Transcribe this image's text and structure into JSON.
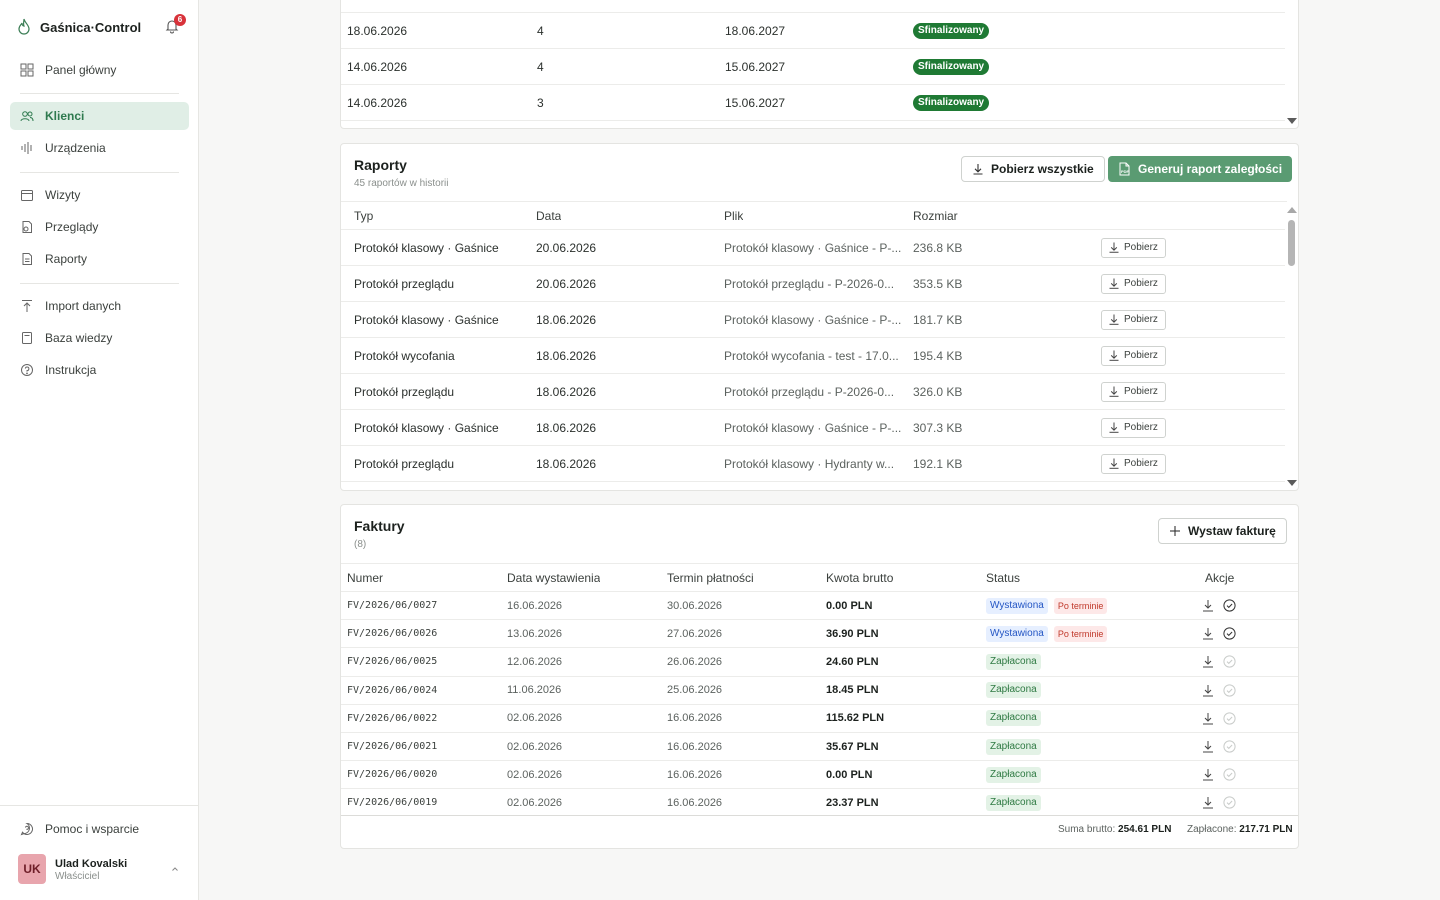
{
  "app": {
    "name": "Gaśnica·Control",
    "notifications": "6"
  },
  "sidebar": {
    "items": [
      {
        "label": "Panel główny",
        "icon": "grid-icon"
      },
      {
        "label": "Klienci",
        "icon": "users-icon",
        "active": true
      },
      {
        "label": "Urządzenia",
        "icon": "signal-icon"
      },
      {
        "label": "Wizyty",
        "icon": "calendar-icon"
      },
      {
        "label": "Przeglądy",
        "icon": "inspect-icon"
      },
      {
        "label": "Raporty",
        "icon": "file-icon"
      },
      {
        "label": "Import danych",
        "icon": "upload-icon"
      },
      {
        "label": "Baza wiedzy",
        "icon": "book-icon"
      },
      {
        "label": "Instrukcja",
        "icon": "help-icon"
      }
    ],
    "support": "Pomoc i wsparcie",
    "user": {
      "initials": "UK",
      "name": "Ulad Kovalski",
      "role": "Właściciel"
    }
  },
  "top_table": {
    "rows": [
      {
        "date": "18.06.2026",
        "count": "4",
        "valid": "18.06.2027",
        "status": "Sfinalizowany"
      },
      {
        "date": "14.06.2026",
        "count": "4",
        "valid": "15.06.2027",
        "status": "Sfinalizowany"
      },
      {
        "date": "14.06.2026",
        "count": "3",
        "valid": "15.06.2027",
        "status": "Sfinalizowany"
      }
    ]
  },
  "reports": {
    "title": "Raporty",
    "subtitle": "45 raportów w historii",
    "download_all": "Pobierz wszystkie",
    "generate": "Generuj raport zaległości",
    "columns": {
      "type": "Typ",
      "date": "Data",
      "file": "Plik",
      "size": "Rozmiar"
    },
    "download_label": "Pobierz",
    "rows": [
      {
        "type": "Protokół klasowy · Gaśnice",
        "date": "20.06.2026",
        "file": "Protokół klasowy · Gaśnice - P-...",
        "size": "236.8 KB"
      },
      {
        "type": "Protokół przeglądu",
        "date": "20.06.2026",
        "file": "Protokół przeglądu - P-2026-0...",
        "size": "353.5 KB"
      },
      {
        "type": "Protokół klasowy · Gaśnice",
        "date": "18.06.2026",
        "file": "Protokół klasowy · Gaśnice - P-...",
        "size": "181.7 KB"
      },
      {
        "type": "Protokół wycofania",
        "date": "18.06.2026",
        "file": "Protokół wycofania - test - 17.0...",
        "size": "195.4 KB"
      },
      {
        "type": "Protokół przeglądu",
        "date": "18.06.2026",
        "file": "Protokół przeglądu - P-2026-0...",
        "size": "326.0 KB"
      },
      {
        "type": "Protokół klasowy · Gaśnice",
        "date": "18.06.2026",
        "file": "Protokół klasowy · Gaśnice - P-...",
        "size": "307.3 KB"
      },
      {
        "type": "Protokół przeglądu",
        "date": "18.06.2026",
        "file": "Protokół klasowy · Hydranty w...",
        "size": "192.1 KB"
      }
    ]
  },
  "invoices": {
    "title": "Faktury",
    "count": "(8)",
    "issue_button": "Wystaw fakturę",
    "columns": {
      "number": "Numer",
      "issued": "Data wystawienia",
      "due": "Termin płatności",
      "amount": "Kwota brutto",
      "status": "Status",
      "actions": "Akcje"
    },
    "rows": [
      {
        "number": "FV/2026/06/0027",
        "issued": "16.06.2026",
        "due": "30.06.2026",
        "amount": "0.00 PLN",
        "status": "Wystawiona",
        "overdue": "Po terminie"
      },
      {
        "number": "FV/2026/06/0026",
        "issued": "13.06.2026",
        "due": "27.06.2026",
        "amount": "36.90 PLN",
        "status": "Wystawiona",
        "overdue": "Po terminie"
      },
      {
        "number": "FV/2026/06/0025",
        "issued": "12.06.2026",
        "due": "26.06.2026",
        "amount": "24.60 PLN",
        "status": "Zapłacona"
      },
      {
        "number": "FV/2026/06/0024",
        "issued": "11.06.2026",
        "due": "25.06.2026",
        "amount": "18.45 PLN",
        "status": "Zapłacona"
      },
      {
        "number": "FV/2026/06/0022",
        "issued": "02.06.2026",
        "due": "16.06.2026",
        "amount": "115.62 PLN",
        "status": "Zapłacona"
      },
      {
        "number": "FV/2026/06/0021",
        "issued": "02.06.2026",
        "due": "16.06.2026",
        "amount": "35.67 PLN",
        "status": "Zapłacona"
      },
      {
        "number": "FV/2026/06/0020",
        "issued": "02.06.2026",
        "due": "16.06.2026",
        "amount": "0.00 PLN",
        "status": "Zapłacona"
      },
      {
        "number": "FV/2026/06/0019",
        "issued": "02.06.2026",
        "due": "16.06.2026",
        "amount": "23.37 PLN",
        "status": "Zapłacona"
      }
    ],
    "summary": {
      "gross_label": "Suma brutto:",
      "gross_value": "254.61 PLN",
      "paid_label": "Zapłacone:",
      "paid_value": "217.71 PLN"
    }
  },
  "colors": {
    "accent": "#5a9b72",
    "active_bg": "#e0eee6",
    "badge_done": "#1f7a34",
    "danger": "#d8323a"
  }
}
